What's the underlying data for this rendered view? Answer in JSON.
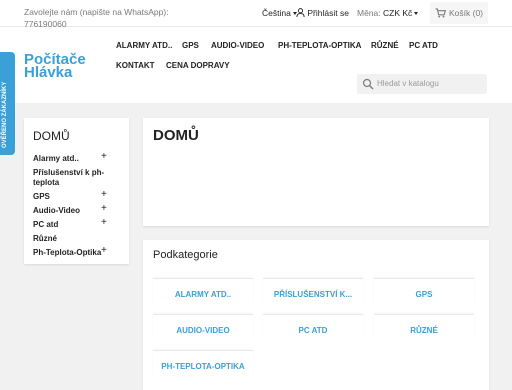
{
  "topbar": {
    "contact_text": "Zavolejte nám (napište na WhatsApp): 776190060",
    "language": "Čeština",
    "login": "Přihlásit se",
    "currency_label": "Měna:",
    "currency_value": "CZK Kč",
    "cart": "Košík (0)"
  },
  "header": {
    "logo_line1": "Počítače",
    "logo_line2": "Hlávka",
    "nav": [
      "ALARMY ATD..",
      "GPS",
      "AUDIO-VIDEO",
      "PH-TEPLOTA-OPTIKA",
      "RŮZNÉ",
      "PC ATD",
      "KONTAKT",
      "CENA DOPRAVY"
    ],
    "search_placeholder": "Hledat v katalogu"
  },
  "badge": {
    "text": "OVĚŘENO ZÁKAZNÍKY"
  },
  "sidebar": {
    "title": "DOMŮ",
    "categories": [
      {
        "label": "Alarmy atd..",
        "expand": "+"
      },
      {
        "label": "Příslušenství k ph-teplota",
        "expand": ""
      },
      {
        "label": "GPS",
        "expand": "+"
      },
      {
        "label": "Audio-Video",
        "expand": "+"
      },
      {
        "label": "PC atd",
        "expand": "+"
      },
      {
        "label": "Různé",
        "expand": ""
      },
      {
        "label": "Ph-Teplota-Optika",
        "expand": "+"
      }
    ]
  },
  "main": {
    "title": "DOMŮ",
    "subcategories_heading": "Podkategorie",
    "subcategories": [
      "ALARMY ATD..",
      "PŘÍSLUŠENSTVÍ K...",
      "GPS",
      "AUDIO-VIDEO",
      "PC ATD",
      "RŮZNÉ",
      "PH-TEPLOTA-OPTIKA"
    ]
  },
  "colors": {
    "accent": "#3aa0d7",
    "text": "#232323",
    "background": "#f1f1f1"
  }
}
